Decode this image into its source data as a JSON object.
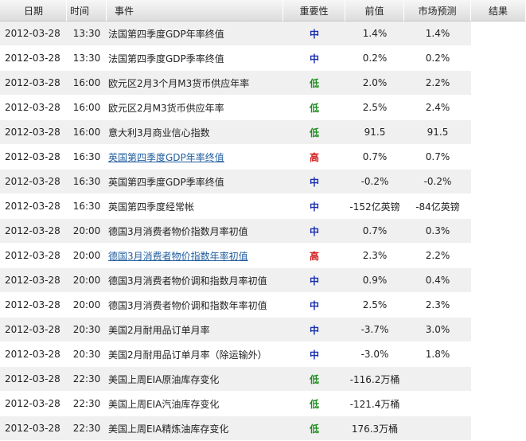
{
  "headers": {
    "date": "日期",
    "time": "时间",
    "event": "事件",
    "importance": "重要性",
    "previous": "前值",
    "forecast": "市场预测",
    "result": "结果"
  },
  "importance_colors": {
    "中": "#1a2fb0",
    "低": "#1e8e1e",
    "高": "#d21a1a"
  },
  "rows": [
    {
      "date": "2012-03-28",
      "time": "13:30",
      "event": "法国第四季度GDP年率终值",
      "importance": "中",
      "previous": "1.4%",
      "forecast": "1.4%",
      "result": "",
      "link": false
    },
    {
      "date": "2012-03-28",
      "time": "13:30",
      "event": "法国第四季度GDP季率终值",
      "importance": "中",
      "previous": "0.2%",
      "forecast": "0.2%",
      "result": "",
      "link": false
    },
    {
      "date": "2012-03-28",
      "time": "16:00",
      "event": "欧元区2月3个月M3货币供应年率",
      "importance": "低",
      "previous": "2.0%",
      "forecast": "2.2%",
      "result": "",
      "link": false
    },
    {
      "date": "2012-03-28",
      "time": "16:00",
      "event": "欧元区2月M3货币供应年率",
      "importance": "低",
      "previous": "2.5%",
      "forecast": "2.4%",
      "result": "",
      "link": false
    },
    {
      "date": "2012-03-28",
      "time": "16:00",
      "event": "意大利3月商业信心指数",
      "importance": "低",
      "previous": "91.5",
      "forecast": "91.5",
      "result": "",
      "link": false
    },
    {
      "date": "2012-03-28",
      "time": "16:30",
      "event": "英国第四季度GDP年率终值",
      "importance": "高",
      "previous": "0.7%",
      "forecast": "0.7%",
      "result": "",
      "link": true
    },
    {
      "date": "2012-03-28",
      "time": "16:30",
      "event": "英国第四季度GDP季率终值",
      "importance": "中",
      "previous": "-0.2%",
      "forecast": "-0.2%",
      "result": "",
      "link": false
    },
    {
      "date": "2012-03-28",
      "time": "16:30",
      "event": "英国第四季度经常帐",
      "importance": "中",
      "previous": "-152亿英镑",
      "forecast": "-84亿英镑",
      "result": "",
      "link": false
    },
    {
      "date": "2012-03-28",
      "time": "20:00",
      "event": "德国3月消费者物价指数月率初值",
      "importance": "中",
      "previous": "0.7%",
      "forecast": "0.3%",
      "result": "",
      "link": false
    },
    {
      "date": "2012-03-28",
      "time": "20:00",
      "event": "德国3月消费者物价指数年率初值",
      "importance": "高",
      "previous": "2.3%",
      "forecast": "2.2%",
      "result": "",
      "link": true
    },
    {
      "date": "2012-03-28",
      "time": "20:00",
      "event": "德国3月消费者物价调和指数月率初值",
      "importance": "中",
      "previous": "0.9%",
      "forecast": "0.4%",
      "result": "",
      "link": false
    },
    {
      "date": "2012-03-28",
      "time": "20:00",
      "event": "德国3月消费者物价调和指数年率初值",
      "importance": "中",
      "previous": "2.5%",
      "forecast": "2.3%",
      "result": "",
      "link": false
    },
    {
      "date": "2012-03-28",
      "time": "20:30",
      "event": "美国2月耐用品订单月率",
      "importance": "中",
      "previous": "-3.7%",
      "forecast": "3.0%",
      "result": "",
      "link": false
    },
    {
      "date": "2012-03-28",
      "time": "20:30",
      "event": "美国2月耐用品订单月率（除运输外）",
      "importance": "中",
      "previous": "-3.0%",
      "forecast": "1.8%",
      "result": "",
      "link": false
    },
    {
      "date": "2012-03-28",
      "time": "22:30",
      "event": "美国上周EIA原油库存变化",
      "importance": "低",
      "previous": "-116.2万桶",
      "forecast": "",
      "result": "",
      "link": false
    },
    {
      "date": "2012-03-28",
      "time": "22:30",
      "event": "美国上周EIA汽油库存变化",
      "importance": "低",
      "previous": "-121.4万桶",
      "forecast": "",
      "result": "",
      "link": false
    },
    {
      "date": "2012-03-28",
      "time": "22:30",
      "event": "美国上周EIA精炼油库存变化",
      "importance": "低",
      "previous": "176.3万桶",
      "forecast": "",
      "result": "",
      "link": false
    }
  ]
}
